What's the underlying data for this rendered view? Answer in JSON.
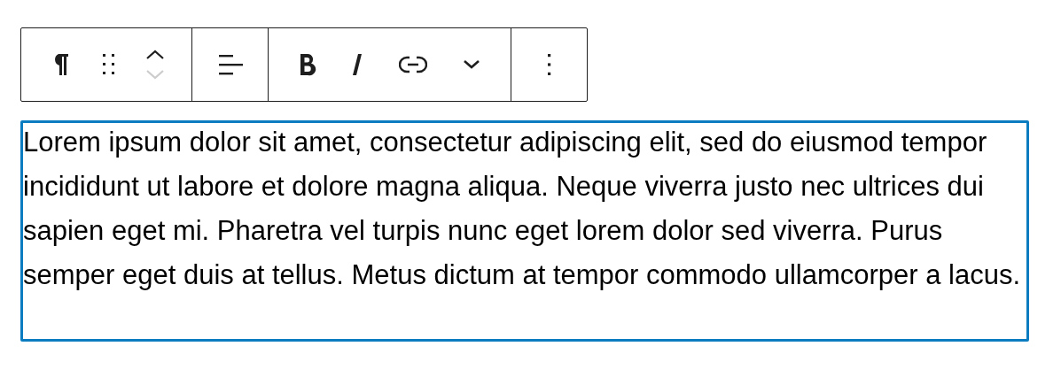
{
  "toolbar": {
    "groups": [
      {
        "buttons": [
          {
            "kind": "paragraph"
          },
          {
            "kind": "drag"
          },
          {
            "kind": "mover",
            "up_disabled": false,
            "down_disabled": true
          }
        ]
      },
      {
        "buttons": [
          {
            "kind": "align"
          }
        ]
      },
      {
        "buttons": [
          {
            "kind": "bold"
          },
          {
            "kind": "italic"
          },
          {
            "kind": "link"
          },
          {
            "kind": "more"
          }
        ]
      },
      {
        "buttons": [
          {
            "kind": "options"
          }
        ]
      }
    ]
  },
  "paragraph": {
    "text": "Lorem ipsum dolor sit amet, consectetur adipiscing elit, sed do eiusmod tempor incididunt ut labore et dolore magna aliqua. Neque viverra justo nec ultrices dui sapien eget mi. Pharetra vel turpis nunc eget lorem dolor sed viverra. Purus semper eget duis at tellus. Metus dictum at tempor commodo ullamcorper a lacus.",
    "selected": true
  }
}
